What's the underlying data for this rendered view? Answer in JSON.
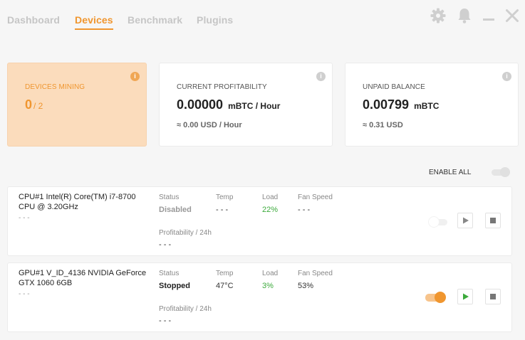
{
  "nav": {
    "tabs": [
      {
        "label": "Dashboard"
      },
      {
        "label": "Devices"
      },
      {
        "label": "Benchmark"
      },
      {
        "label": "Plugins"
      }
    ],
    "active_tab": "Devices"
  },
  "window_icons": [
    "gear-icon",
    "bell-icon",
    "minimize-icon",
    "close-icon"
  ],
  "cards": {
    "mining": {
      "title": "DEVICES MINING",
      "value": "0",
      "total": "/ 2",
      "info": "i"
    },
    "profitability": {
      "title": "CURRENT PROFITABILITY",
      "value": "0.00000",
      "unit": "mBTC / Hour",
      "sub": "≈ 0.00 USD / Hour",
      "info": "i"
    },
    "balance": {
      "title": "UNPAID BALANCE",
      "value": "0.00799",
      "unit": "mBTC",
      "sub": "≈ 0.31 USD",
      "info": "i"
    }
  },
  "enable_all": {
    "label": "ENABLE ALL",
    "enabled": false
  },
  "field_labels": {
    "status": "Status",
    "temp": "Temp",
    "load": "Load",
    "fan": "Fan Speed",
    "profit": "Profitability / 24h"
  },
  "devices": [
    {
      "name": "CPU#1 Intel(R) Core(TM) i7-8700 CPU @ 3.20GHz",
      "sub": "- - -",
      "status": "Disabled",
      "temp": "- - -",
      "load": "22%",
      "fan": "- - -",
      "profit": "- - -",
      "enabled": false
    },
    {
      "name": "GPU#1 V_ID_4136 NVIDIA GeForce GTX 1060 6GB",
      "sub": "- - -",
      "status": "Stopped",
      "temp": "47°C",
      "load": "3%",
      "fan": "53%",
      "profit": "- - -",
      "enabled": true
    }
  ],
  "colors": {
    "accent": "#f0962f",
    "mining_card_bg": "#fbdcbc",
    "load_green": "#3caa3c",
    "play_green": "#3caa3c"
  }
}
